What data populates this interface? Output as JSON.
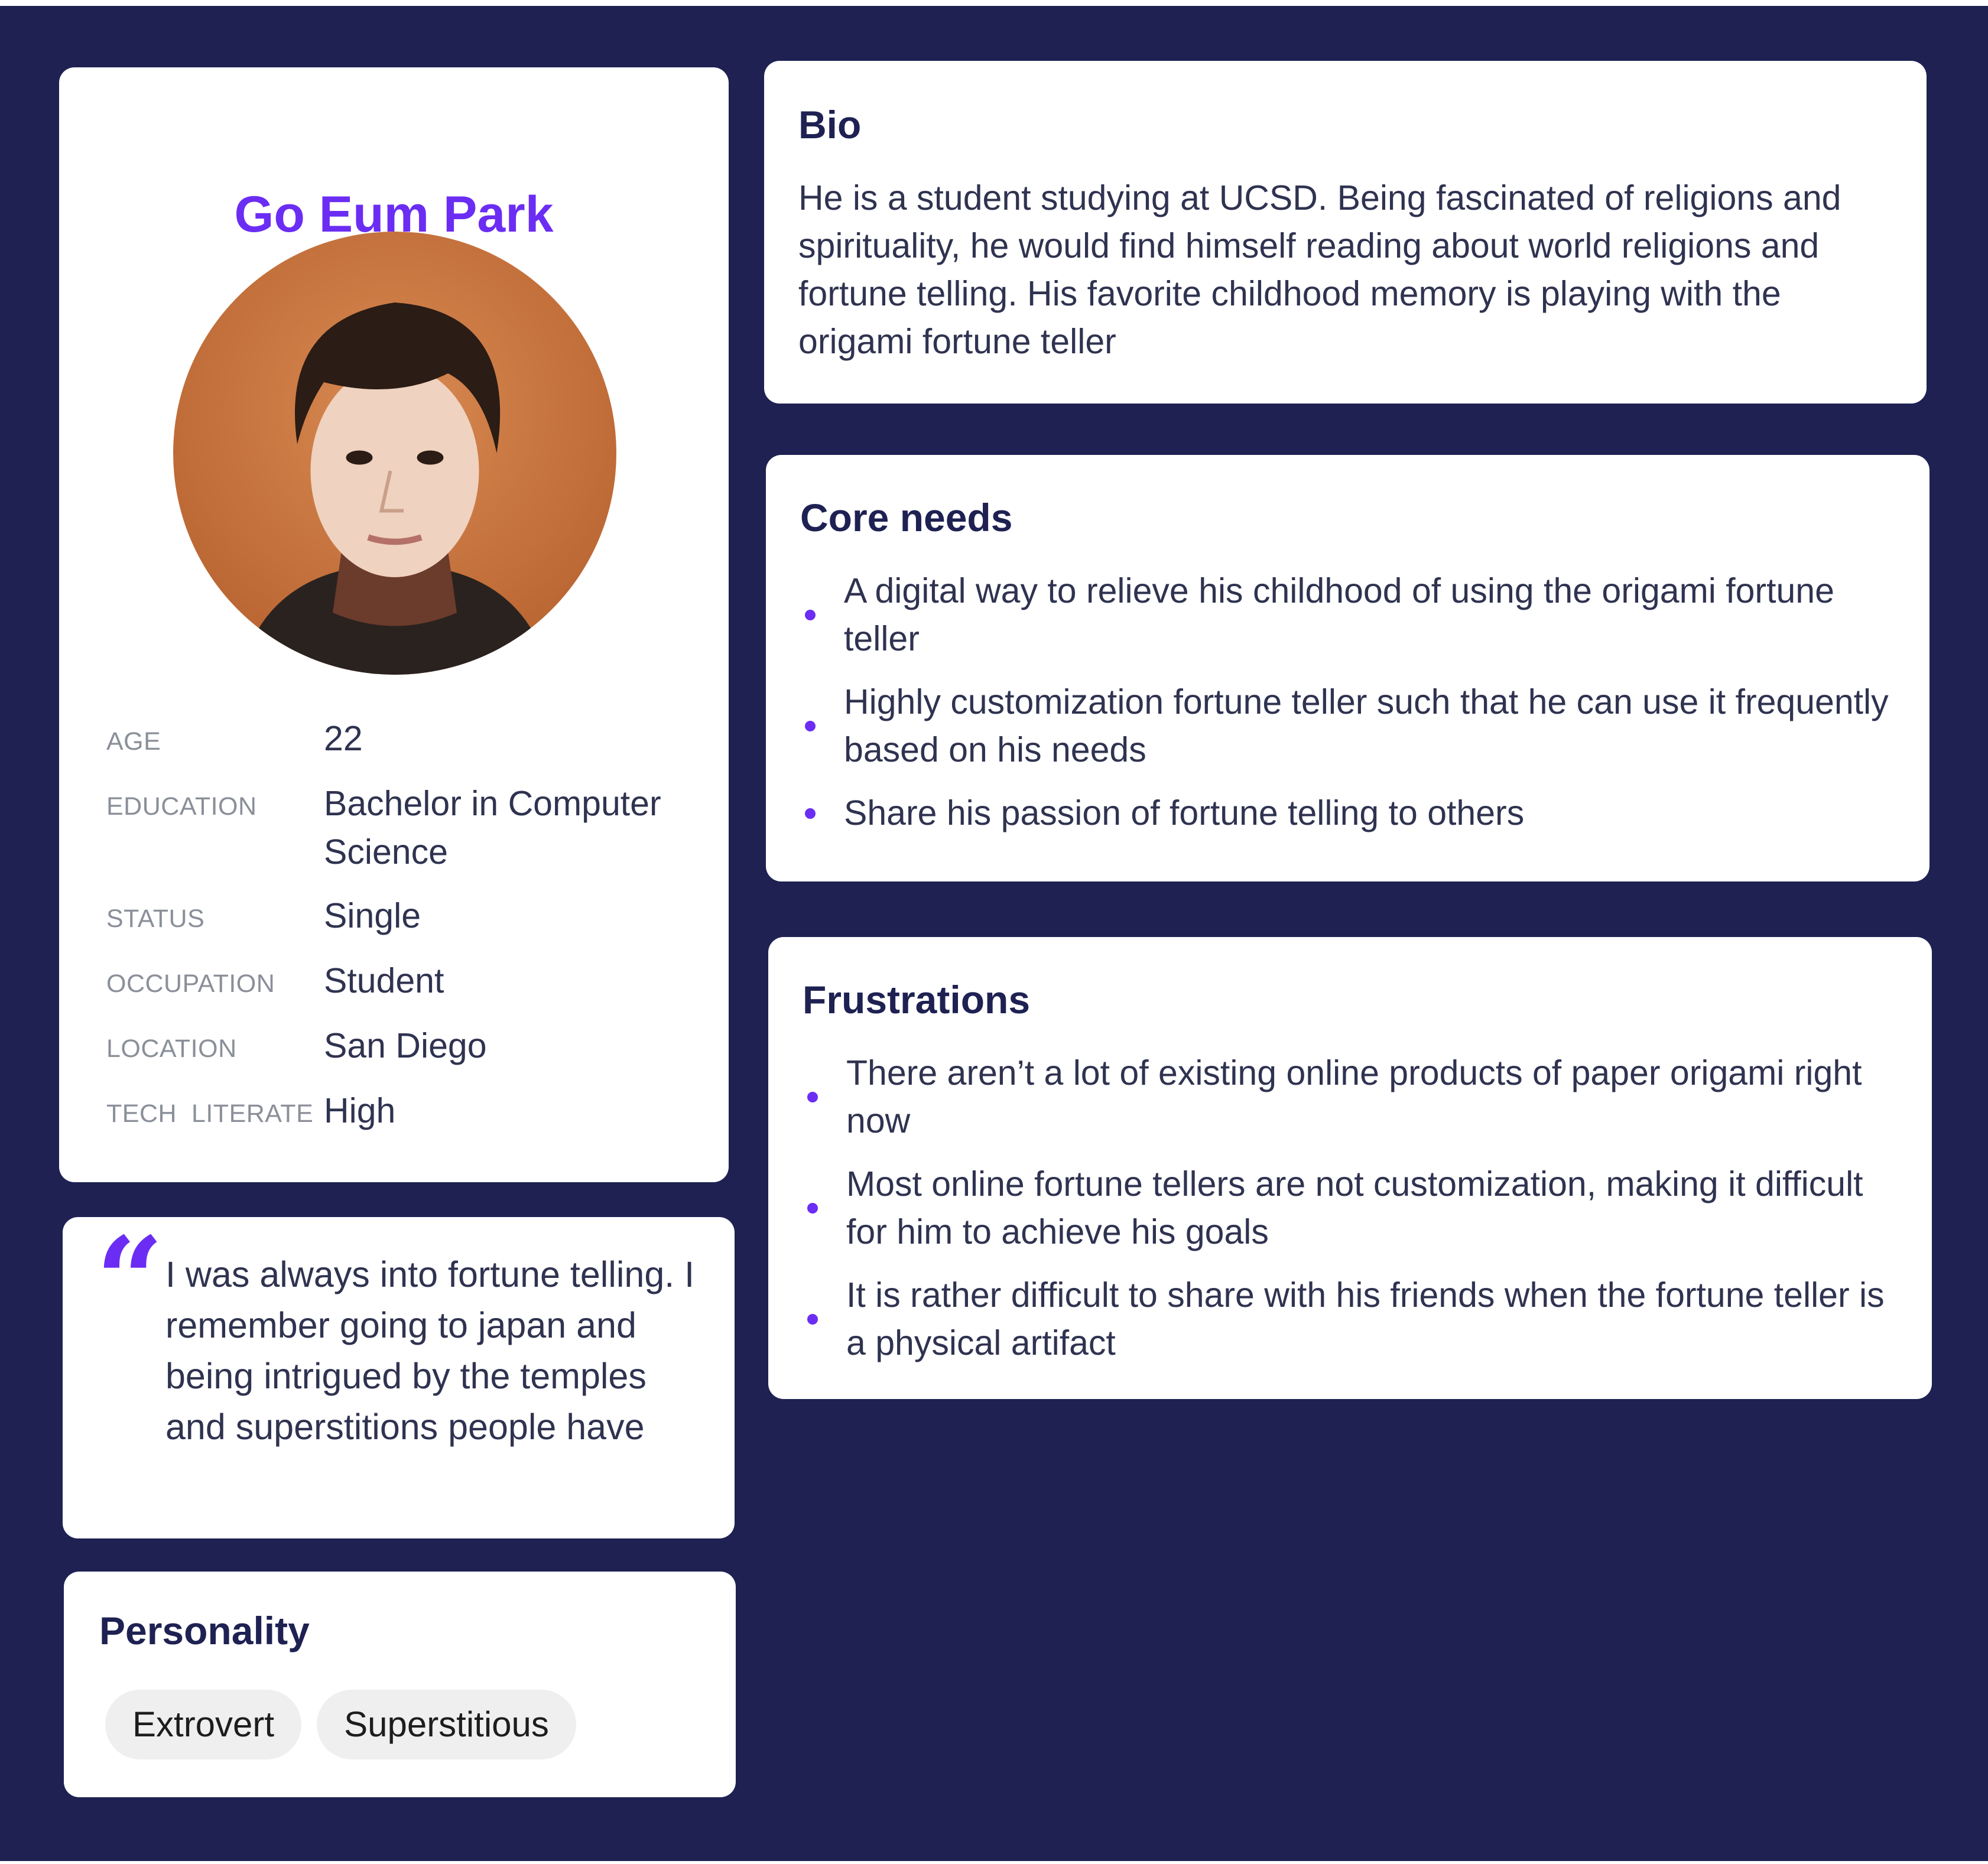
{
  "colors": {
    "background": "#1e2152",
    "card": "#ffffff",
    "accent": "#6b2df3",
    "text": "#2f3350",
    "label": "#8a8f99",
    "tag_bg": "#efefef"
  },
  "profile": {
    "name": "Go Eum Park",
    "avatar_icon": "portrait-photo",
    "facts": [
      {
        "label": "AGE",
        "value": "22"
      },
      {
        "label": "EDUCATION",
        "value": "Bachelor in Computer Science"
      },
      {
        "label": "STATUS",
        "value": "Single"
      },
      {
        "label": "OCCUPATION",
        "value": "Student"
      },
      {
        "label": "LOCATION",
        "value": "San Diego"
      },
      {
        "label": "TECH  LITERATE",
        "value": "High"
      }
    ]
  },
  "quote": {
    "mark": "“",
    "text": "I was always into fortune telling. I remember going to japan and being intrigued by the temples and superstitions people have"
  },
  "personality": {
    "title": "Personality",
    "tags": [
      "Extrovert",
      "Superstitious"
    ]
  },
  "bio": {
    "title": "Bio",
    "text": "He is a student studying at UCSD. Being fascinated of religions and spirituality, he would find himself reading about world religions and fortune telling. His favorite childhood memory is playing with the origami fortune teller"
  },
  "core_needs": {
    "title": "Core needs",
    "items": [
      "A digital way to relieve his childhood of using the origami fortune teller",
      "Highly customization fortune teller such that he can use it frequently based on his needs",
      "Share his passion of fortune telling to others"
    ]
  },
  "frustrations": {
    "title": "Frustrations",
    "items": [
      "There aren’t a lot of existing online products of paper origami right now",
      "Most online fortune tellers are not customization, making it difficult for him to achieve his goals",
      "It is rather difficult to share with his friends when the fortune teller is a physical artifact"
    ]
  }
}
